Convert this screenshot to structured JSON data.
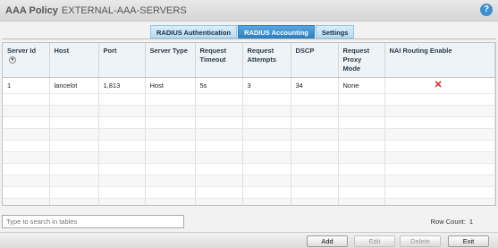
{
  "header": {
    "title": "AAA Policy",
    "subtitle": "EXTERNAL-AAA-SERVERS",
    "help_glyph": "?"
  },
  "tabs": [
    {
      "label": "RADIUS Authentication",
      "active": false
    },
    {
      "label": "RADIUS Accounting",
      "active": true
    },
    {
      "label": "Settings",
      "active": false
    }
  ],
  "table": {
    "columns": [
      "Server Id",
      "Host",
      "Port",
      "Server Type",
      "Request Timeout",
      "Request Attempts",
      "DSCP",
      "Request Proxy Mode",
      "NAI Routing Enable"
    ],
    "rows": [
      {
        "server_id": "1",
        "host": "lancelot",
        "port": "1,813",
        "server_type": "Host",
        "request_timeout": "5s",
        "request_attempts": "3",
        "dscp": "34",
        "request_proxy_mode": "None",
        "nai_routing_enable": "✕"
      }
    ]
  },
  "search": {
    "placeholder": "Type to search in tables"
  },
  "row_count": {
    "label": "Row Count:",
    "value": "1"
  },
  "buttons": {
    "add": "Add",
    "edit": "Edit",
    "delete": "Delete",
    "exit": "Exit"
  },
  "colors": {
    "accent": "#2f7fbf",
    "danger": "#d22222"
  }
}
